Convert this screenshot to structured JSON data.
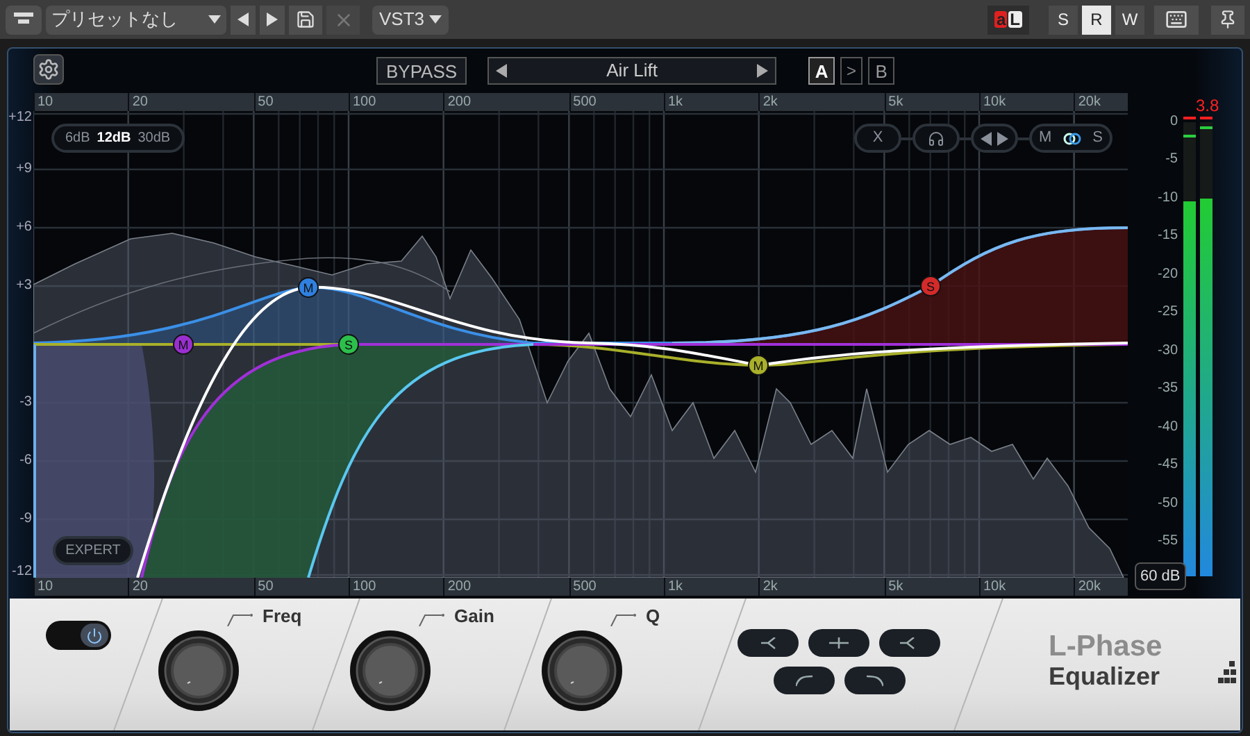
{
  "toolbar": {
    "preset": "プリセットなし",
    "format": "VST3",
    "monitor_badge": [
      "a",
      "L"
    ],
    "modes": [
      {
        "label": "S",
        "selected": false
      },
      {
        "label": "R",
        "selected": true
      },
      {
        "label": "W",
        "selected": false
      }
    ]
  },
  "header": {
    "bypass": "BYPASS",
    "preset": "Air Lift",
    "copy": ">",
    "slots": [
      {
        "label": "A",
        "selected": true
      },
      {
        "label": "B",
        "selected": false
      }
    ]
  },
  "top_ruler": [
    "10",
    "20",
    "50",
    "100",
    "200",
    "500",
    "1k",
    "2k",
    "5k",
    "10k",
    "20k"
  ],
  "bottom_ruler": [
    "10",
    "20",
    "50",
    "100",
    "200",
    "500",
    "1k",
    "2k",
    "5k",
    "10k",
    "20k"
  ],
  "db_labels": [
    "+12",
    "+9",
    "+6",
    "+3",
    "-3",
    "-6",
    "-9",
    "-12"
  ],
  "range_options": [
    {
      "label": "6dB",
      "selected": false
    },
    {
      "label": "12dB",
      "selected": true
    },
    {
      "label": "30dB",
      "selected": false
    }
  ],
  "solo_controls": {
    "clear": "X",
    "mid": "M",
    "side": "S",
    "linked": true
  },
  "expert": "EXPERT",
  "nodes": [
    {
      "label": "M",
      "color": "#9a2fd0"
    },
    {
      "label": "M",
      "color": "#2f80e0"
    },
    {
      "label": "S",
      "color": "#2cbf4c"
    },
    {
      "label": "M",
      "color": "#a9b02a"
    },
    {
      "label": "S",
      "color": "#d42a2a"
    }
  ],
  "meter": {
    "peak": "3.8",
    "range": "60 dB",
    "scale": [
      "0",
      "-5",
      "-10",
      "-15",
      "-20",
      "-25",
      "-30",
      "-35",
      "-40",
      "-45",
      "-50",
      "-55"
    ],
    "channels": [
      {
        "level": 0.826
      },
      {
        "level": 0.832
      }
    ]
  },
  "band": {
    "on": true,
    "knobs": [
      "Freq",
      "Gain",
      "Q"
    ]
  },
  "logo": [
    "L-Phase",
    "Equalizer"
  ]
}
